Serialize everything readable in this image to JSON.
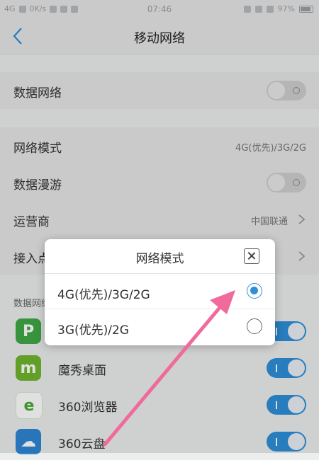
{
  "status": {
    "network": "4G",
    "speed": "0K/s",
    "time": "07:46",
    "battery": "97%"
  },
  "header": {
    "title": "移动网络"
  },
  "rows": {
    "data_network": {
      "label": "数据网络"
    },
    "network_mode": {
      "label": "网络模式",
      "value": "4G(优先)/3G/2G"
    },
    "roaming": {
      "label": "数据漫游"
    },
    "carrier": {
      "label": "运营商",
      "value": "中国联通"
    },
    "apn": {
      "label": "接入点"
    }
  },
  "apps_section": {
    "label": "数据网络"
  },
  "apps": [
    {
      "name": "",
      "icon": "app-p-icon",
      "color": "#3fa946"
    },
    {
      "name": "魔秀桌面",
      "icon": "moxiu-icon",
      "color": "#6fb52c"
    },
    {
      "name": "360浏览器",
      "icon": "360-browser-icon",
      "color": "#49a935"
    },
    {
      "name": "360云盘",
      "icon": "360-cloud-icon",
      "color": "#2f86d3"
    }
  ],
  "dialog": {
    "title": "网络模式",
    "options": [
      {
        "label": "4G(优先)/3G/2G",
        "selected": true
      },
      {
        "label": "3G(优先)/2G",
        "selected": false
      }
    ]
  },
  "colors": {
    "accent": "#2d8fd8",
    "arrow": "#f06a9c"
  }
}
